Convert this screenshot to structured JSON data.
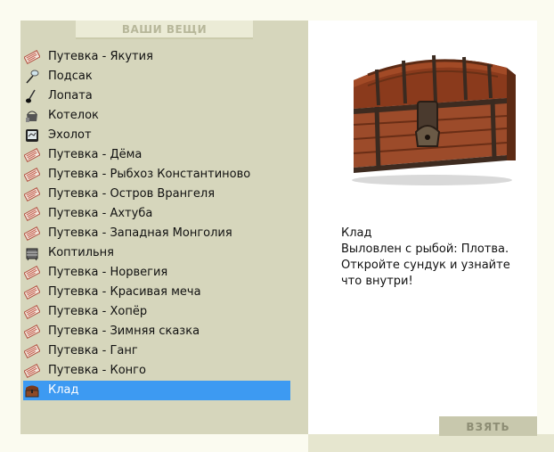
{
  "header": {
    "title": "ВАШИ ВЕЩИ"
  },
  "items": [
    {
      "label": "Путевка - Якутия",
      "icon": "ticket-icon"
    },
    {
      "label": "Подсак",
      "icon": "landing-net-icon"
    },
    {
      "label": "Лопата",
      "icon": "shovel-icon"
    },
    {
      "label": "Котелок",
      "icon": "pot-icon"
    },
    {
      "label": "Эхолот",
      "icon": "echo-sounder-icon"
    },
    {
      "label": "Путевка - Дёма",
      "icon": "ticket-icon"
    },
    {
      "label": "Путевка - Рыбхоз Константиново",
      "icon": "ticket-icon"
    },
    {
      "label": "Путевка - Остров Врангеля",
      "icon": "ticket-icon"
    },
    {
      "label": "Путевка - Ахтуба",
      "icon": "ticket-icon"
    },
    {
      "label": "Путевка - Западная Монголия",
      "icon": "ticket-icon"
    },
    {
      "label": "Коптильня",
      "icon": "smokehouse-icon"
    },
    {
      "label": "Путевка - Норвегия",
      "icon": "ticket-icon"
    },
    {
      "label": "Путевка - Красивая меча",
      "icon": "ticket-icon"
    },
    {
      "label": "Путевка - Хопёр",
      "icon": "ticket-icon"
    },
    {
      "label": "Путевка - Зимняя сказка",
      "icon": "ticket-icon"
    },
    {
      "label": "Путевка - Ганг",
      "icon": "ticket-icon"
    },
    {
      "label": "Путевка - Конго",
      "icon": "ticket-icon"
    },
    {
      "label": "Клад",
      "icon": "chest-icon",
      "selected": true
    }
  ],
  "details": {
    "title": "Клад",
    "line1": "Выловлен с рыбой: Плотва.",
    "line2": "Откройте сундук и узнайте",
    "line3": "что внутри!"
  },
  "actions": {
    "take_label": "ВЗЯТЬ"
  },
  "colors": {
    "panel_bg": "#d6d6bc",
    "selection": "#3d9af2",
    "button_bg": "#c8c8ad",
    "header_text": "#b7b79a"
  }
}
